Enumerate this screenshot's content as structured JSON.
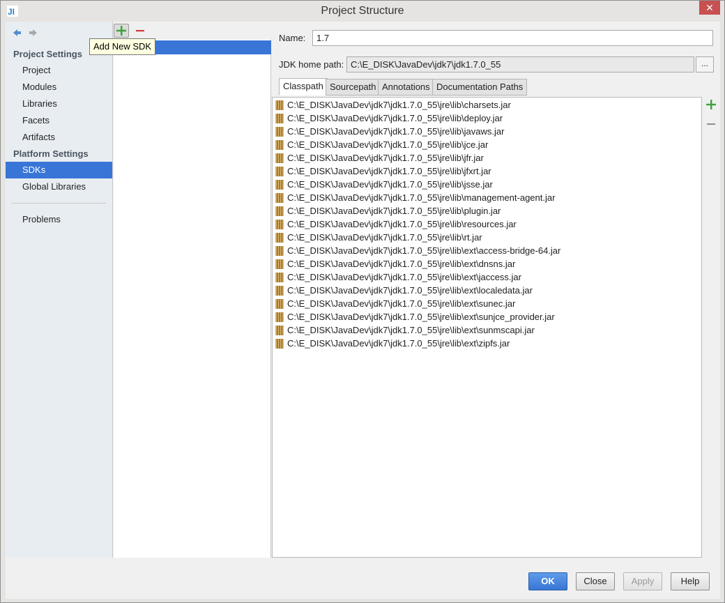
{
  "window": {
    "title": "Project Structure"
  },
  "nav": {
    "groups": [
      "Project Settings",
      "Platform Settings"
    ],
    "project_items": [
      "Project",
      "Modules",
      "Libraries",
      "Facets",
      "Artifacts"
    ],
    "platform_items": [
      "SDKs",
      "Global Libraries"
    ],
    "problems": "Problems",
    "selected": "SDKs"
  },
  "sdk_panel": {
    "tooltip": "Add New SDK"
  },
  "detail": {
    "name_label": "Name:",
    "name_value": "1.7",
    "jdk_path_label": "JDK home path:",
    "jdk_path_value": "C:\\E_DISK\\JavaDev\\jdk7\\jdk1.7.0_55",
    "browse_label": "...",
    "tabs": [
      "Classpath",
      "Sourcepath",
      "Annotations",
      "Documentation Paths"
    ],
    "active_tab": "Classpath",
    "classpath": [
      "C:\\E_DISK\\JavaDev\\jdk7\\jdk1.7.0_55\\jre\\lib\\charsets.jar",
      "C:\\E_DISK\\JavaDev\\jdk7\\jdk1.7.0_55\\jre\\lib\\deploy.jar",
      "C:\\E_DISK\\JavaDev\\jdk7\\jdk1.7.0_55\\jre\\lib\\javaws.jar",
      "C:\\E_DISK\\JavaDev\\jdk7\\jdk1.7.0_55\\jre\\lib\\jce.jar",
      "C:\\E_DISK\\JavaDev\\jdk7\\jdk1.7.0_55\\jre\\lib\\jfr.jar",
      "C:\\E_DISK\\JavaDev\\jdk7\\jdk1.7.0_55\\jre\\lib\\jfxrt.jar",
      "C:\\E_DISK\\JavaDev\\jdk7\\jdk1.7.0_55\\jre\\lib\\jsse.jar",
      "C:\\E_DISK\\JavaDev\\jdk7\\jdk1.7.0_55\\jre\\lib\\management-agent.jar",
      "C:\\E_DISK\\JavaDev\\jdk7\\jdk1.7.0_55\\jre\\lib\\plugin.jar",
      "C:\\E_DISK\\JavaDev\\jdk7\\jdk1.7.0_55\\jre\\lib\\resources.jar",
      "C:\\E_DISK\\JavaDev\\jdk7\\jdk1.7.0_55\\jre\\lib\\rt.jar",
      "C:\\E_DISK\\JavaDev\\jdk7\\jdk1.7.0_55\\jre\\lib\\ext\\access-bridge-64.jar",
      "C:\\E_DISK\\JavaDev\\jdk7\\jdk1.7.0_55\\jre\\lib\\ext\\dnsns.jar",
      "C:\\E_DISK\\JavaDev\\jdk7\\jdk1.7.0_55\\jre\\lib\\ext\\jaccess.jar",
      "C:\\E_DISK\\JavaDev\\jdk7\\jdk1.7.0_55\\jre\\lib\\ext\\localedata.jar",
      "C:\\E_DISK\\JavaDev\\jdk7\\jdk1.7.0_55\\jre\\lib\\ext\\sunec.jar",
      "C:\\E_DISK\\JavaDev\\jdk7\\jdk1.7.0_55\\jre\\lib\\ext\\sunjce_provider.jar",
      "C:\\E_DISK\\JavaDev\\jdk7\\jdk1.7.0_55\\jre\\lib\\ext\\sunmscapi.jar",
      "C:\\E_DISK\\JavaDev\\jdk7\\jdk1.7.0_55\\jre\\lib\\ext\\zipfs.jar"
    ]
  },
  "buttons": {
    "ok": "OK",
    "close": "Close",
    "apply": "Apply",
    "help": "Help"
  },
  "colors": {
    "selection": "#3875d7",
    "add": "#3aa33a",
    "remove": "#d03a3a",
    "tooltip_bg": "#ffffe1"
  }
}
